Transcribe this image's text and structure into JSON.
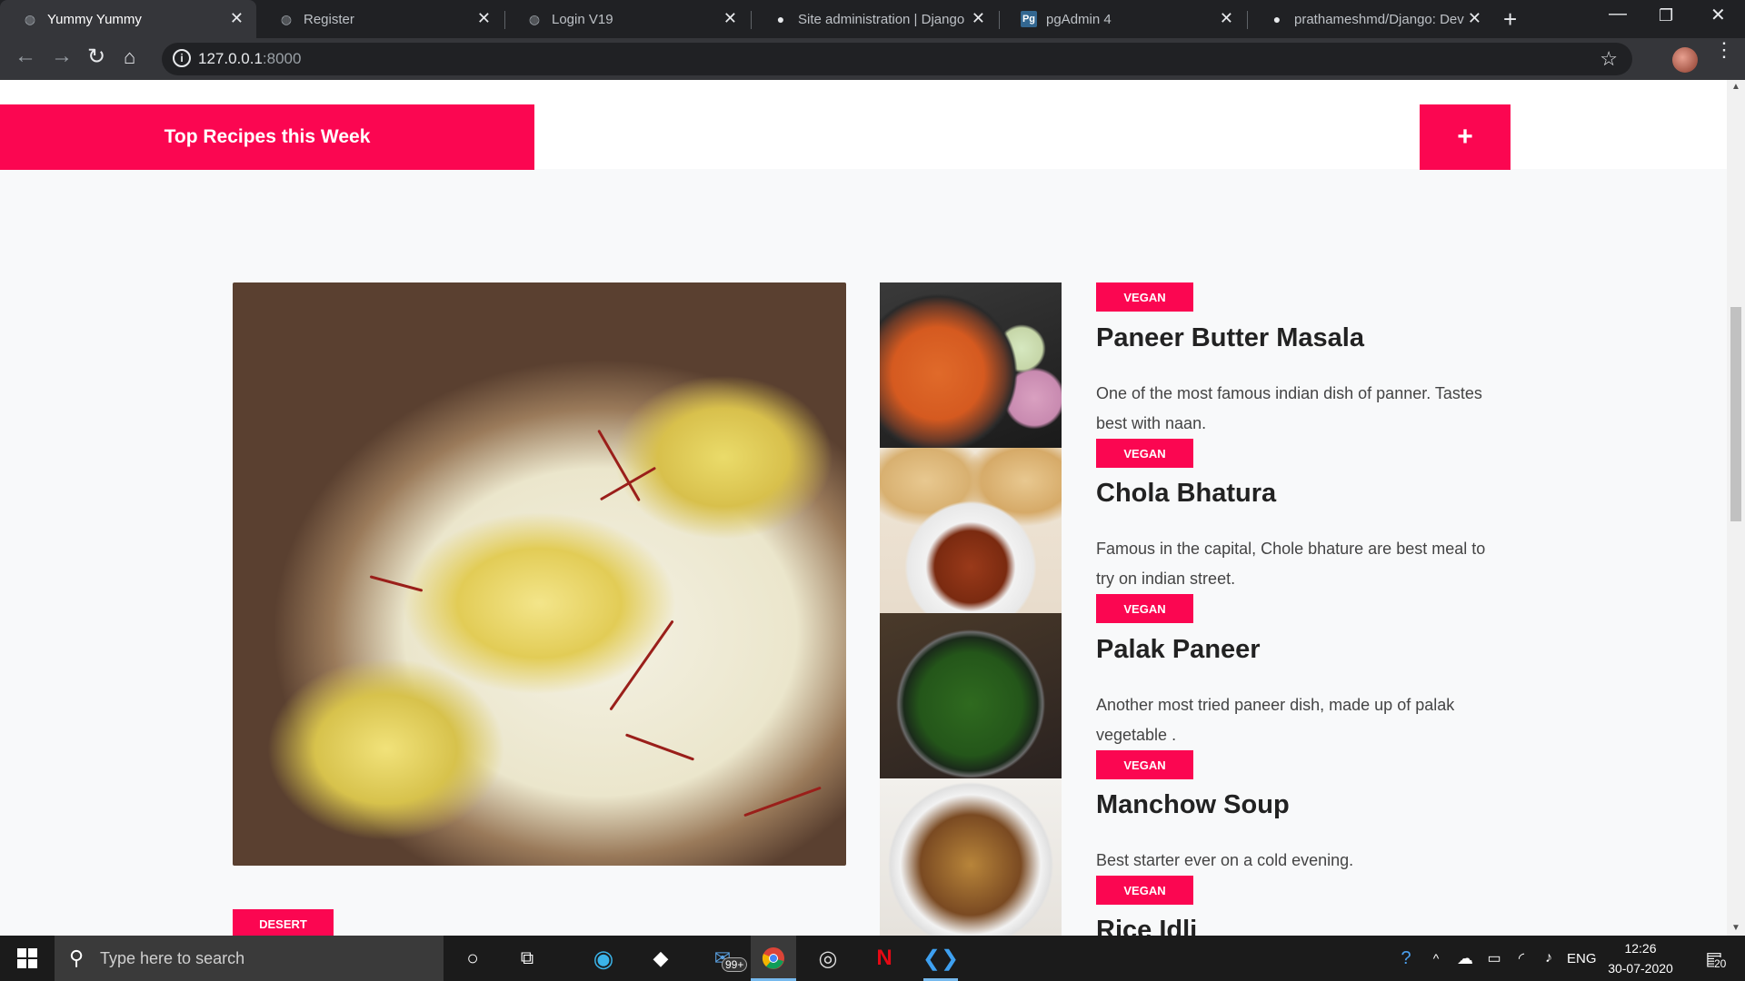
{
  "browser": {
    "tabs": [
      {
        "title": "Yummy Yummy",
        "icon": "globe-icon",
        "active": true
      },
      {
        "title": "Register",
        "icon": "globe-icon",
        "active": false
      },
      {
        "title": "Login V19",
        "icon": "globe-icon",
        "active": false
      },
      {
        "title": "Site administration | Django",
        "icon": "globe-icon",
        "active": false
      },
      {
        "title": "pgAdmin 4",
        "icon": "pgadmin-icon",
        "active": false
      },
      {
        "title": "prathameshmd/Django: Dev",
        "icon": "github-icon",
        "active": false
      }
    ],
    "url_host": "127.0.0.1",
    "url_port": ":8000"
  },
  "page": {
    "top_button": "Top Recipes this Week",
    "plus_button": "+",
    "featured_tag": "DESERT",
    "recipes": [
      {
        "tag": "VEGAN",
        "title": "Paneer Butter Masala",
        "desc": "One of the most famous indian dish of panner. Tastes best with naan."
      },
      {
        "tag": "VEGAN",
        "title": "Chola Bhatura",
        "desc": "Famous in the capital, Chole bhature are best meal to try on indian street."
      },
      {
        "tag": "VEGAN",
        "title": "Palak Paneer",
        "desc": "Another most tried paneer dish, made up of palak vegetable ."
      },
      {
        "tag": "VEGAN",
        "title": "Manchow Soup",
        "desc": "Best starter ever on a cold evening."
      },
      {
        "tag": "VEGAN",
        "title": "Rice Idli",
        "desc": ""
      }
    ],
    "accent_color": "#fb0651"
  },
  "taskbar": {
    "search_placeholder": "Type here to search",
    "mail_badge": "99+",
    "lang": "ENG",
    "time": "12:26",
    "date": "30-07-2020",
    "notifications": "20"
  }
}
